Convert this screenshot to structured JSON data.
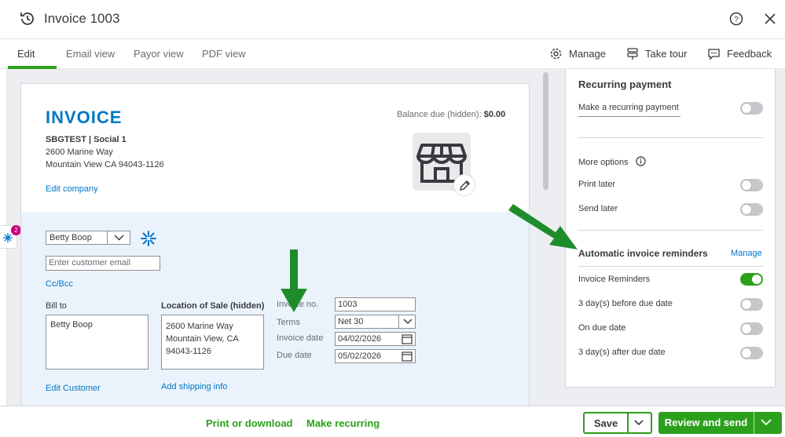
{
  "header": {
    "title": "Invoice 1003"
  },
  "tabs": [
    {
      "label": "Edit"
    },
    {
      "label": "Email view"
    },
    {
      "label": "Payor view"
    },
    {
      "label": "PDF view"
    }
  ],
  "tools": {
    "manage": "Manage",
    "tour": "Take tour",
    "feedback": "Feedback"
  },
  "notifications": {
    "count": "2"
  },
  "invoice": {
    "title": "INVOICE",
    "company_name": "SBGTEST | Social 1",
    "address_line1": "2600 Marine Way",
    "address_line2": "Mountain View CA 94043-1126",
    "edit_company": "Edit company",
    "balance_label": "Balance due (hidden):",
    "balance_value": "$0.00"
  },
  "customer": {
    "selected": "Betty Boop",
    "email_placeholder": "Enter customer email",
    "cc_bcc": "Cc/Bcc",
    "bill_to_label": "Bill to",
    "bill_to_value": "Betty Boop",
    "edit_customer": "Edit Customer",
    "location_label": "Location of Sale (hidden)",
    "location_line1": "2600 Marine Way",
    "location_line2": "Mountain View, CA",
    "location_line3": "94043-1126",
    "add_shipping": "Add shipping info"
  },
  "fields": {
    "invoice_no_label": "Invoice no.",
    "invoice_no": "1003",
    "terms_label": "Terms",
    "terms": "Net 30",
    "invoice_date_label": "Invoice date",
    "invoice_date": "04/02/2026",
    "due_date_label": "Due date",
    "due_date": "05/02/2026"
  },
  "panel": {
    "recurring_title": "Recurring payment",
    "recurring_option": "Make a recurring payment",
    "recurring_on": false,
    "more_options": "More options",
    "print_later": "Print later",
    "print_later_on": false,
    "send_later": "Send later",
    "send_later_on": false,
    "reminders_title": "Automatic invoice reminders",
    "reminders_manage": "Manage",
    "invoice_reminders": "Invoice Reminders",
    "invoice_reminders_on": true,
    "before_due": "3 day(s) before due date",
    "before_due_on": false,
    "on_due": "On due date",
    "on_due_on": false,
    "after_due": "3 day(s) after due date",
    "after_due_on": false
  },
  "footer": {
    "print": "Print or download",
    "recurring": "Make recurring",
    "save": "Save",
    "review_send": "Review and send"
  },
  "colors": {
    "accent": "#2ca01c",
    "link": "#0077c5",
    "arrow": "#1f8c2b"
  }
}
